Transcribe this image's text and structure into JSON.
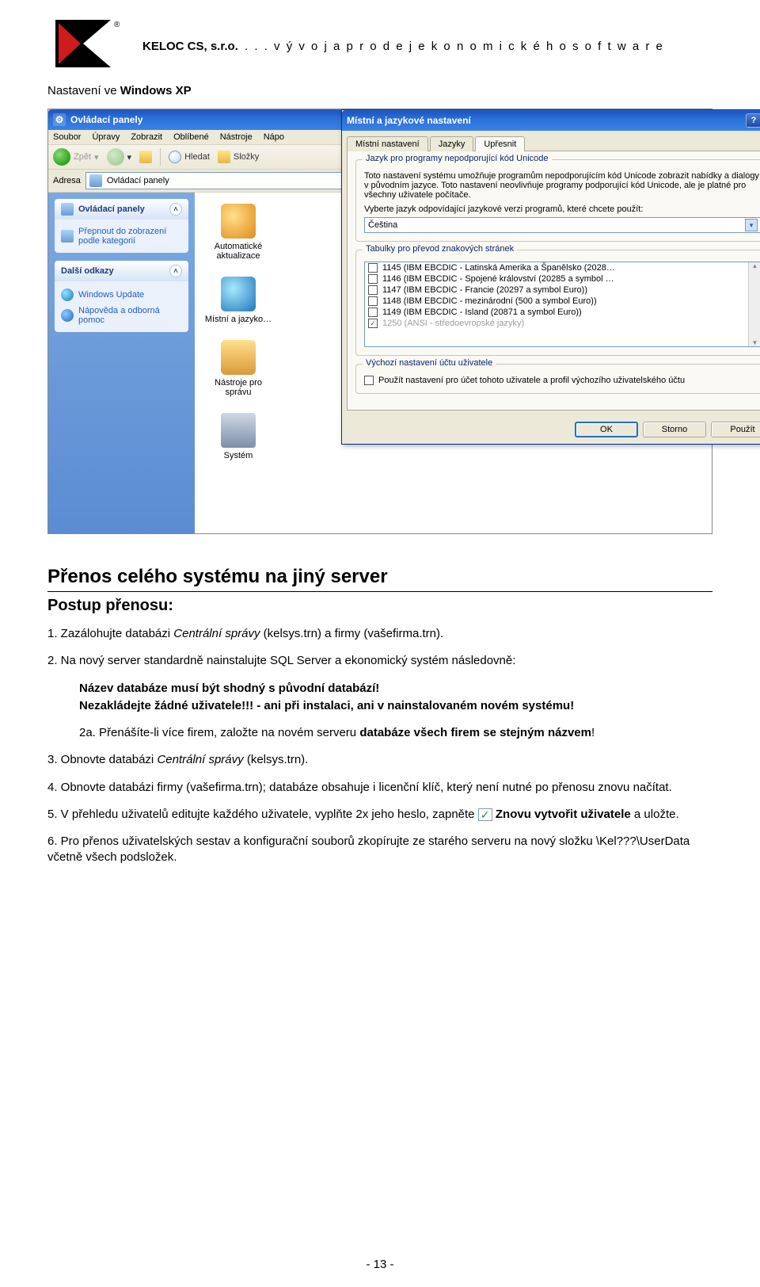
{
  "header": {
    "company": "KELOC CS, s.r.o.",
    "tagline": ". . .  v ý v o j  a  p r o d e j  e k o n o m i c k é h o  s o f t w a r e",
    "subtitle_prefix": "Nastavení ve ",
    "subtitle_bold": "Windows XP"
  },
  "controlpanel": {
    "title": "Ovládací panely",
    "menu": [
      "Soubor",
      "Úpravy",
      "Zobrazit",
      "Oblíbené",
      "Nástroje",
      "Nápo"
    ],
    "toolbar": {
      "back": "Zpět",
      "search": "Hledat",
      "folders": "Složky"
    },
    "address_label": "Adresa",
    "address_value": "Ovládací panely",
    "panel1": {
      "title": "Ovládací panely",
      "link1": "Přepnout do zobrazení podle kategorií"
    },
    "panel2": {
      "title": "Další odkazy",
      "links": [
        "Windows Update",
        "Nápověda a odborná pomoc"
      ]
    },
    "categories": [
      "Automatické aktualizace",
      "Místní a jazyko…",
      "Nástroje pro správu",
      "Systém"
    ]
  },
  "dialog": {
    "title": "Místní a jazykové nastavení",
    "tabs": [
      "Místní nastavení",
      "Jazyky",
      "Upřesnit"
    ],
    "group1": {
      "legend": "Jazyk pro programy nepodporující kód Unicode",
      "desc": "Toto nastavení systému umožňuje programům nepodporujícím kód Unicode zobrazit nabídky a dialogy v původním jazyce. Toto nastavení neovlivňuje programy podporující kód Unicode, ale je platné pro všechny uživatele počítače.",
      "desc2": "Vyberte jazyk odpovídající jazykové verzi programů, které chcete použít:",
      "dropdown_value": "Čeština"
    },
    "group2": {
      "legend": "Tabulky pro převod znakových stránek",
      "items": [
        {
          "checked": false,
          "label": "1145 (IBM EBCDIC - Latinská Amerika a Španělsko (2028…"
        },
        {
          "checked": false,
          "label": "1146 (IBM EBCDIC - Spojené království (20285 a symbol …"
        },
        {
          "checked": false,
          "label": "1147 (IBM EBCDIC - Francie (20297 a symbol Euro))"
        },
        {
          "checked": false,
          "label": "1148 (IBM EBCDIC - mezinárodní (500 a symbol Euro))"
        },
        {
          "checked": false,
          "label": "1149 (IBM EBCDIC - Island (20871 a symbol Euro))"
        },
        {
          "checked": true,
          "label": "1250 (ANSI - středoevropské jazyky)",
          "dim": true
        }
      ]
    },
    "group3": {
      "legend": "Výchozí nastavení účtu uživatele",
      "checkbox_label": "Použít nastavení pro účet tohoto uživatele a profil výchozího uživatelského účtu"
    },
    "buttons": {
      "ok": "OK",
      "cancel": "Storno",
      "apply": "Použít"
    }
  },
  "doc": {
    "h1": "Přenos celého systému na jiný server",
    "h2": "Postup přenosu:",
    "p1_a": "1. Zazálohujte databázi ",
    "p1_i": "Centrální správy",
    "p1_b": " (kelsys.trn) a firmy (vašefirma.trn).",
    "p2": "2. Na nový server standardně nainstalujte SQL Server a ekonomický systém následovně:",
    "p_ind1_a": "Název databáze musí být shodný s původní databází!",
    "p_ind2_a": "Nezakládejte žádné uživatele!!! - ani při instalaci, ani v nainstalovaném novém systému!",
    "p_ind3_a": "2a. Přenášíte-li více firem, založte na novém serveru ",
    "p_ind3_b": "databáze všech firem se stejným názvem",
    "p_ind3_c": "!",
    "p3_a": "3. Obnovte databázi ",
    "p3_i": "Centrální správy",
    "p3_b": " (kelsys.trn).",
    "p4": "4. Obnovte databázi firmy (vašefirma.trn); databáze obsahuje i licenční klíč, který není nutné po přenosu znovu načítat.",
    "p5_a": "5. V přehledu uživatelů editujte každého uživatele, vyplňte 2x jeho heslo, zapněte ",
    "p5_b": " Znovu vytvořit uživatele",
    "p5_c": " a uložte.",
    "p6": "6. Pro přenos uživatelských sestav a konfigurační souborů zkopírujte ze starého serveru na nový složku \\Kel???\\UserData včetně všech podsložek.",
    "pagenum": "- 13 -"
  }
}
